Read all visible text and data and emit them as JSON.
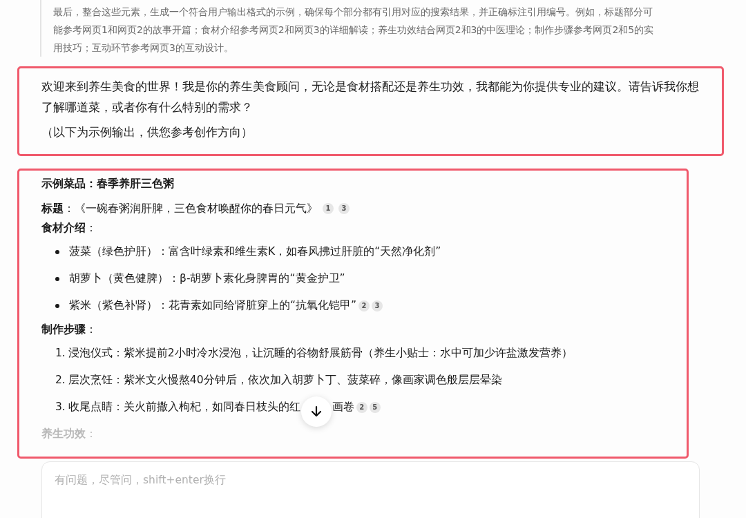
{
  "reasoning": {
    "text": "最后，整合这些元素，生成一个符合用户输出格式的示例，确保每个部分都有引用对应的搜索结果，并正确标注引用编号。例如，标题部分可能参考网页1和网页2的故事开篇；食材介绍参考网页2和网页3的详细解读；养生功效结合网页2和3的中医理论；制作步骤参考网页2和5的实用技巧；互动环节参考网页3的互动设计。"
  },
  "reply": {
    "paragraphs": [
      "欢迎来到养生美食的世界！我是你的养生美食顾问，无论是食材搭配还是养生功效，我都能为你提供专业的建议。请告诉我你想了解哪道菜，或者你有什么特别的需求？",
      "（以下为示例输出，供您参考创作方向）"
    ]
  },
  "example": {
    "dish": "示例菜品：春季养肝三色粥",
    "title": {
      "text": "**标题**：《一碗春粥润肝脾，三色食材唤醒你的春日元气》",
      "citations": [
        "1",
        "3"
      ]
    },
    "sections": [
      {
        "heading": "**食材介绍**：",
        "kind": "bullets",
        "items": [
          {
            "text": "菠菜（绿色护肝）：富含叶绿素和维生素K，如春风拂过肝脏的“天然净化剂”"
          },
          {
            "text": "胡萝卜（黄色健脾）：β-胡萝卜素化身脾胃的“黄金护卫”"
          },
          {
            "text": "紫米（紫色补肾）：花青素如同给肾脏穿上的“抗氧化铠甲”",
            "citations": [
              "2",
              "3"
            ]
          }
        ]
      },
      {
        "heading": "**制作步骤**：",
        "kind": "numbered",
        "items": [
          {
            "number": "1.",
            "text": "浸泡仪式：紫米提前2小时冷水浸泡，让沉睡的谷物舒展筋骨（养生小贴士：水中可加少许盐激发营养）"
          },
          {
            "number": "2.",
            "text": "层次烹饪：紫米文火慢熬40分钟后，依次加入胡萝卜丁、菠菜碎，像画家调色般层层晕染"
          },
          {
            "number": "3.",
            "text": "收尾点睛：关火前撒入枸杞，如同春日枝头的红",
            "text_after": "画卷",
            "citations": [
              "2",
              "5"
            ]
          }
        ]
      },
      {
        "heading": "**养生功效**：",
        "kind": "faded"
      }
    ]
  },
  "input": {
    "placeholder": "有问题，尽管问，shift+enter换行"
  }
}
